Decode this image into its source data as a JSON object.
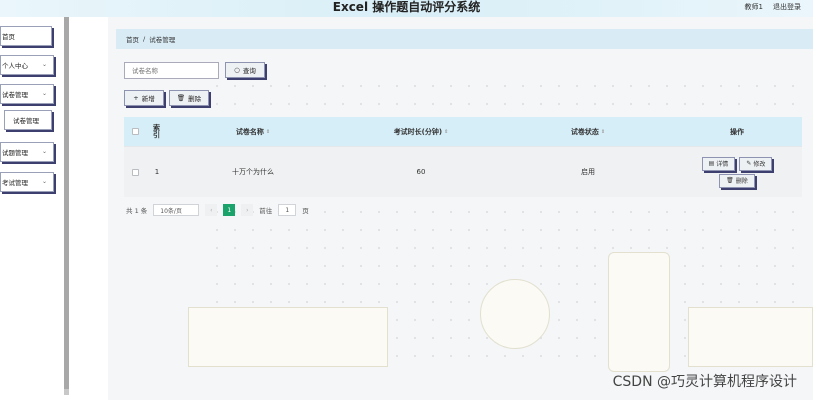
{
  "header": {
    "title": "Excel 操作题自动评分系统",
    "user": "教师1",
    "logout": "退出登录"
  },
  "sidebar": {
    "items": [
      {
        "label": "首页"
      },
      {
        "label": "个人中心"
      },
      {
        "label": "试卷管理"
      },
      {
        "label": "试卷管理"
      },
      {
        "label": "试题管理"
      },
      {
        "label": "考试管理"
      }
    ]
  },
  "breadcrumb": {
    "home": "首页",
    "sep": "/",
    "current": "试卷管理"
  },
  "search": {
    "placeholder": "试卷名称",
    "button": "查询"
  },
  "toolbar": {
    "add": "新增",
    "delete": "删除"
  },
  "table": {
    "headers": {
      "index": "索引",
      "name": "试卷名称",
      "duration": "考试时长(分钟)",
      "status": "试卷状态",
      "ops": "操作"
    },
    "rows": [
      {
        "index": "1",
        "name": "十万个为什么",
        "duration": "60",
        "status": "启用",
        "detail": "详情",
        "edit": "修改",
        "delete": "删除"
      }
    ]
  },
  "pagination": {
    "total": "共 1 条",
    "page_size": "10条/页",
    "current": "1",
    "goto_label": "前往",
    "goto_value": "1",
    "page_unit": "页"
  },
  "watermark": "CSDN @巧灵计算机程序设计"
}
